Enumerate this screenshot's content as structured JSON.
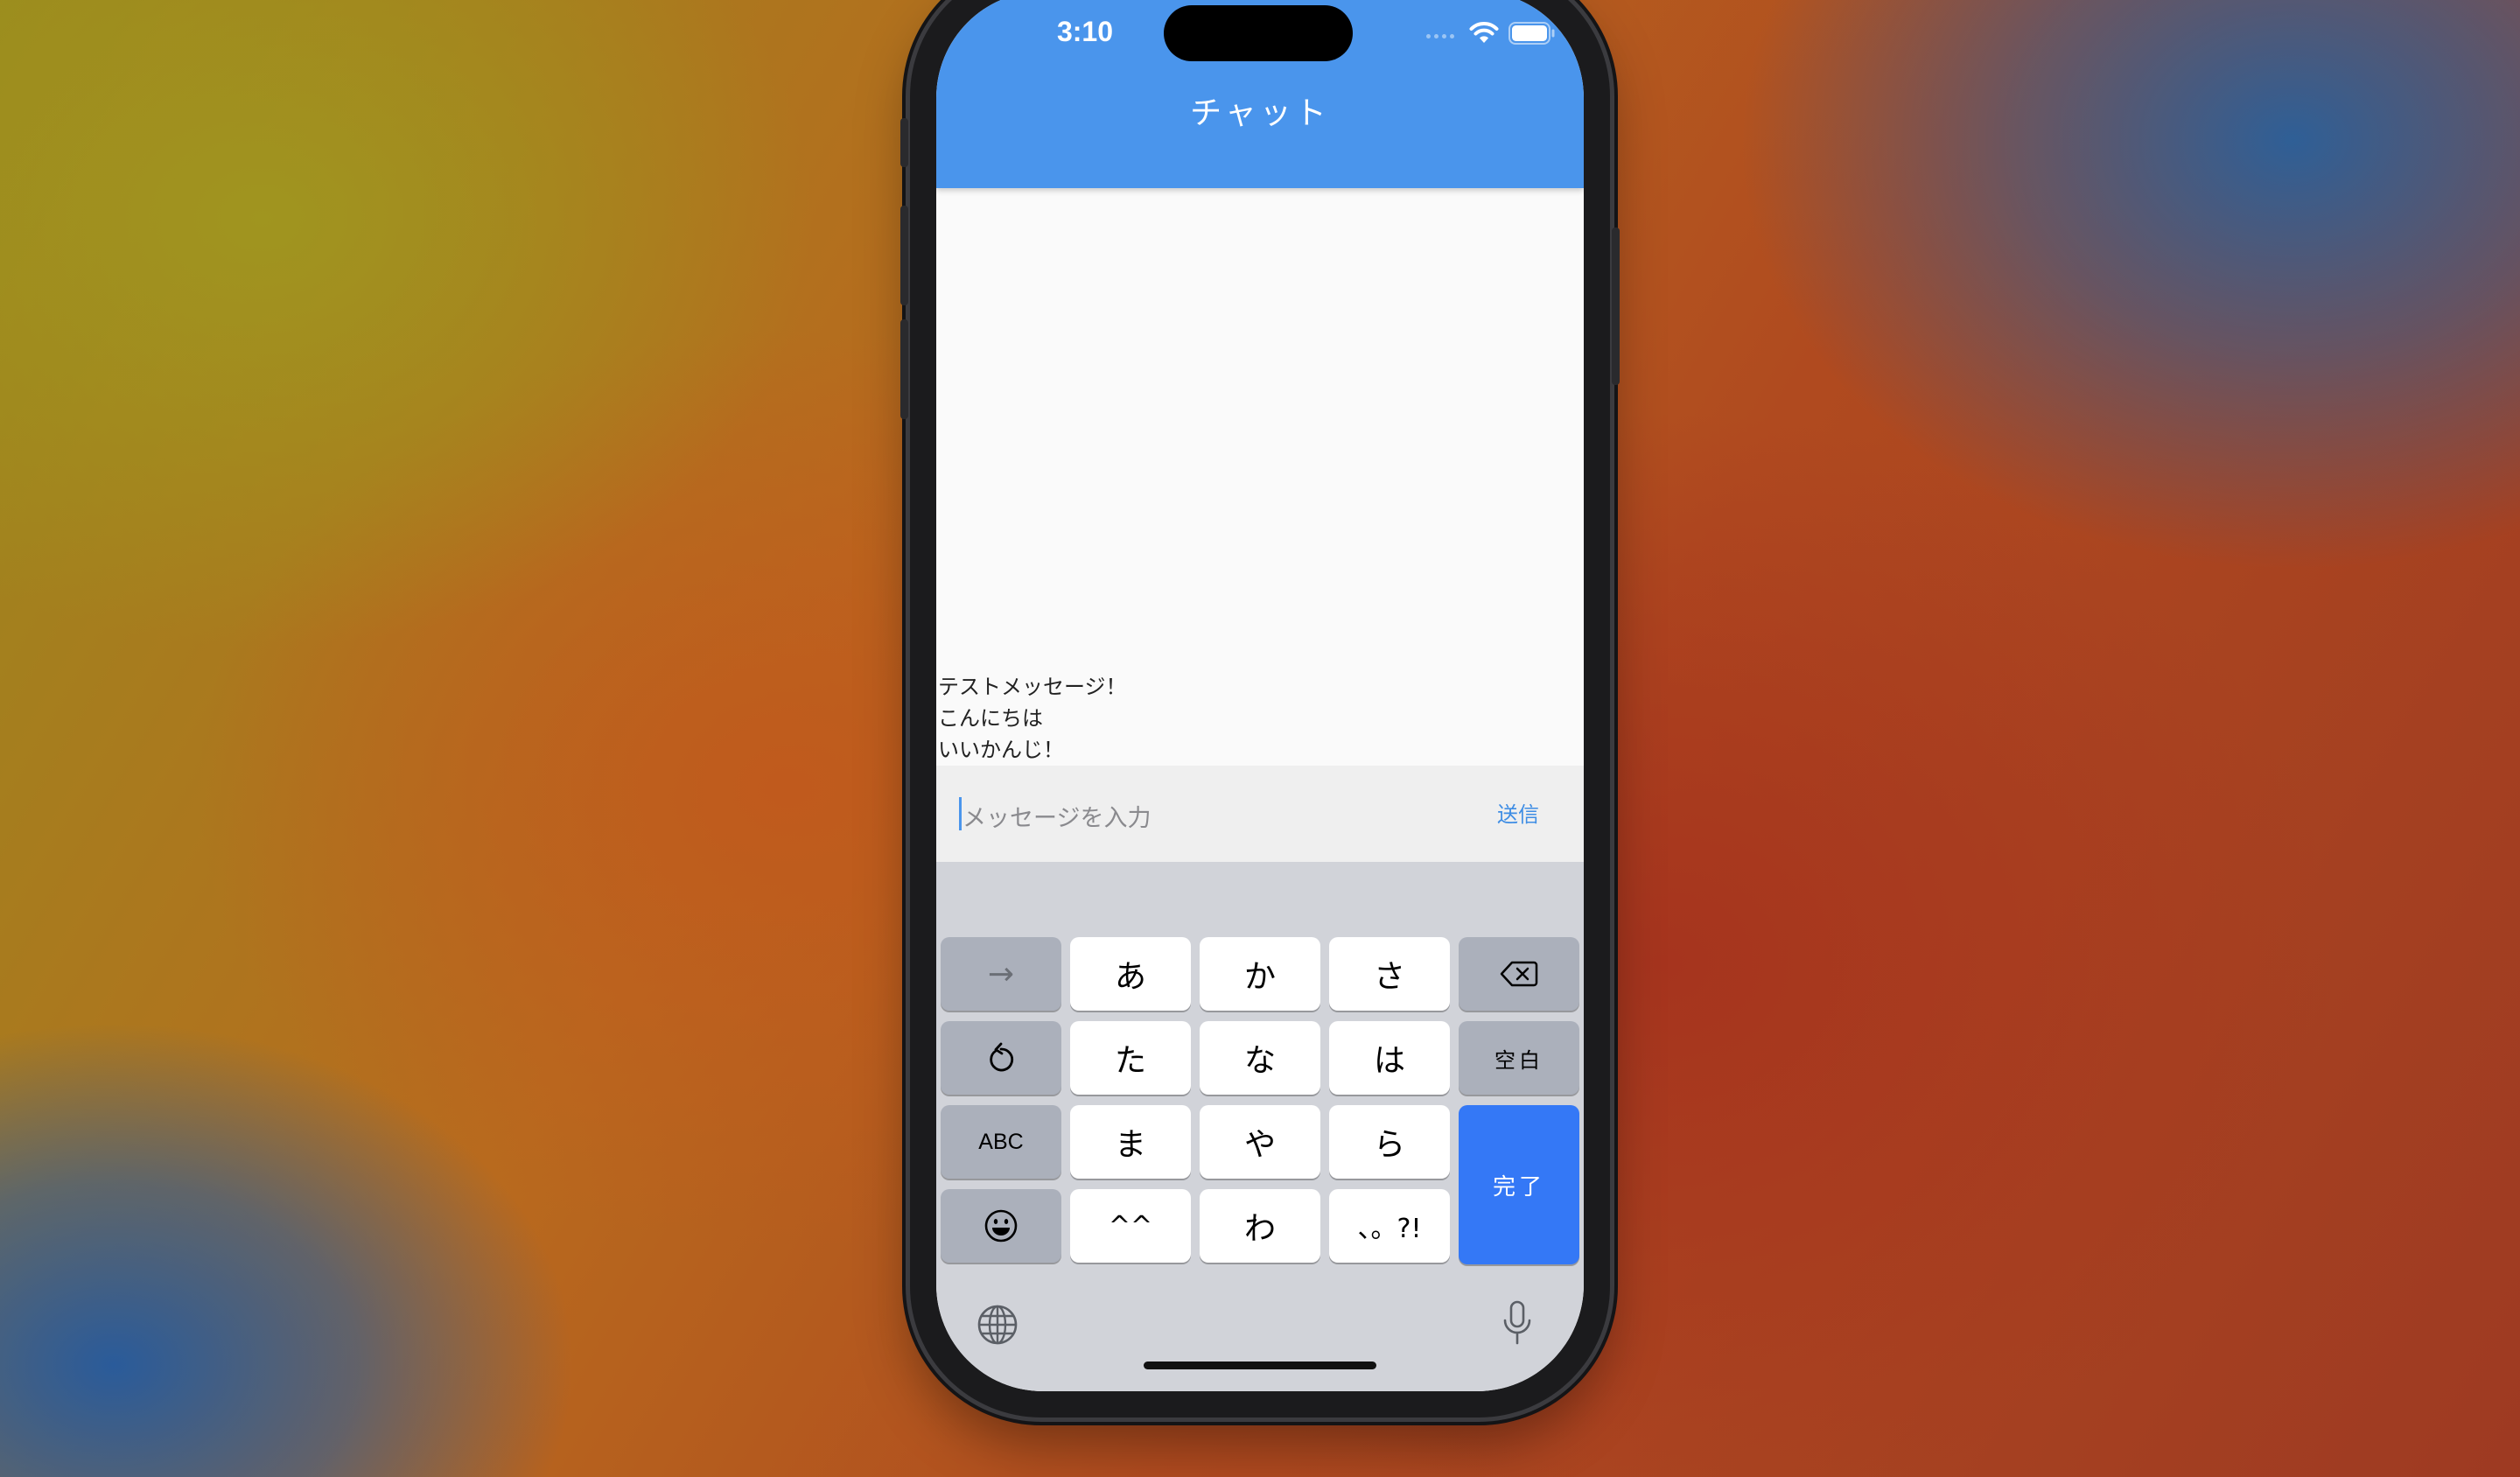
{
  "status_bar": {
    "time": "3:10"
  },
  "nav": {
    "title": "チャット"
  },
  "messages": [
    {
      "text": "テストメッセージ！"
    },
    {
      "text": "こんにちは"
    },
    {
      "text": "いいかんじ！"
    }
  ],
  "composer": {
    "placeholder": "メッセージを入力",
    "send_label": "送信"
  },
  "keyboard": {
    "row1": {
      "k1": "あ",
      "k2": "か",
      "k3": "さ"
    },
    "row2": {
      "k1": "た",
      "k2": "な",
      "k3": "は",
      "space": "空白"
    },
    "row3": {
      "abc": "ABC",
      "k1": "ま",
      "k2": "や",
      "k3": "ら",
      "done": "完了"
    },
    "row4": {
      "k1": "^^",
      "k2": "わ",
      "k3": "、。?!"
    },
    "arrow": "→"
  },
  "colors": {
    "nav_bar": "#4a95ec",
    "done_key": "#3478f6",
    "send_text": "#3e8de4"
  },
  "icons": [
    "wifi-icon",
    "battery-icon",
    "backspace-icon",
    "undo-icon",
    "emoji-icon",
    "globe-icon",
    "microphone-icon"
  ]
}
